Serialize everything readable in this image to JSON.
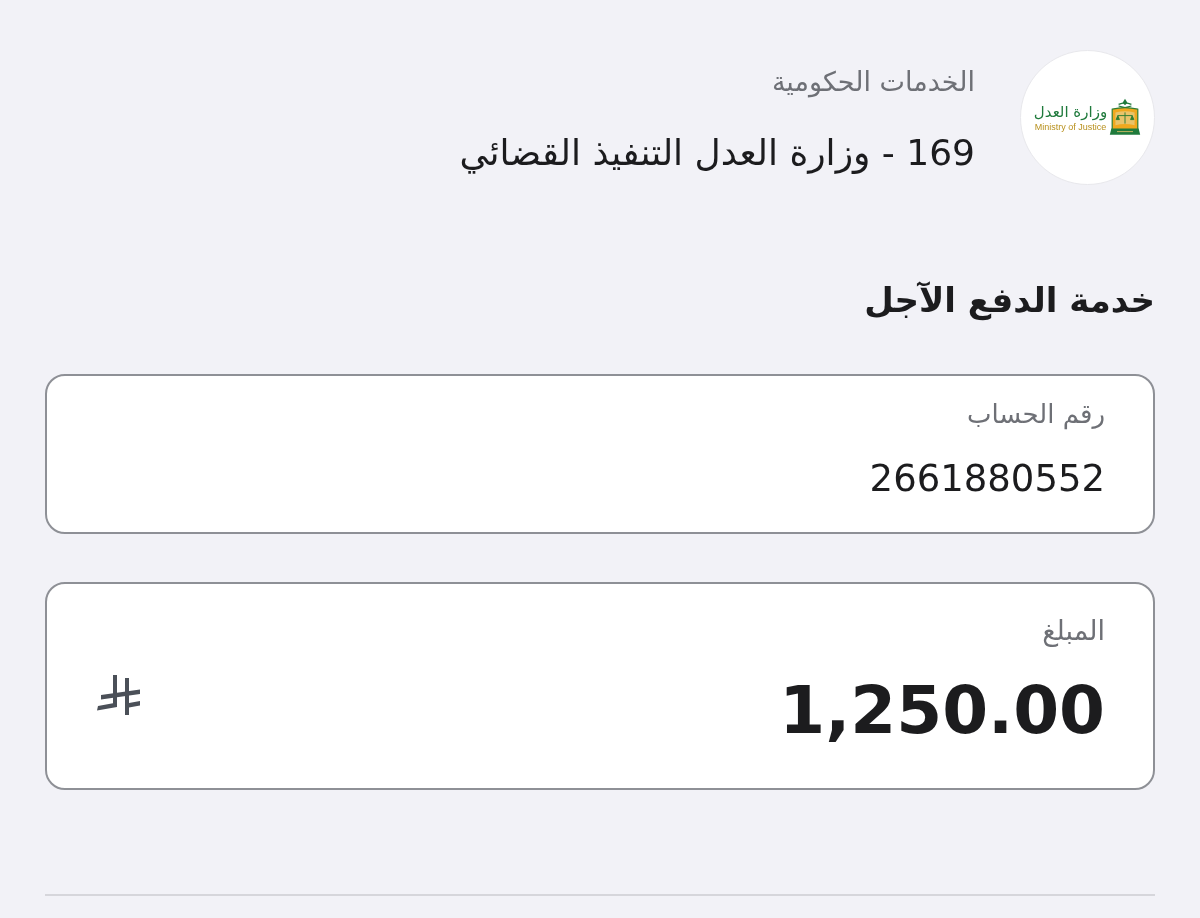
{
  "header": {
    "logo": {
      "arabic_text": "وزارة العدل",
      "english_text": "Ministry of Justice"
    },
    "category": "الخدمات الحكومية",
    "biller": "169 - وزارة العدل التنفيذ القضائي"
  },
  "section_title": "خدمة الدفع الآجل",
  "fields": [
    {
      "kind": "text",
      "label": "رقم الحساب",
      "value": "2661880552"
    },
    {
      "kind": "amount",
      "label": "المبلغ",
      "value": "1,250.00"
    }
  ]
}
